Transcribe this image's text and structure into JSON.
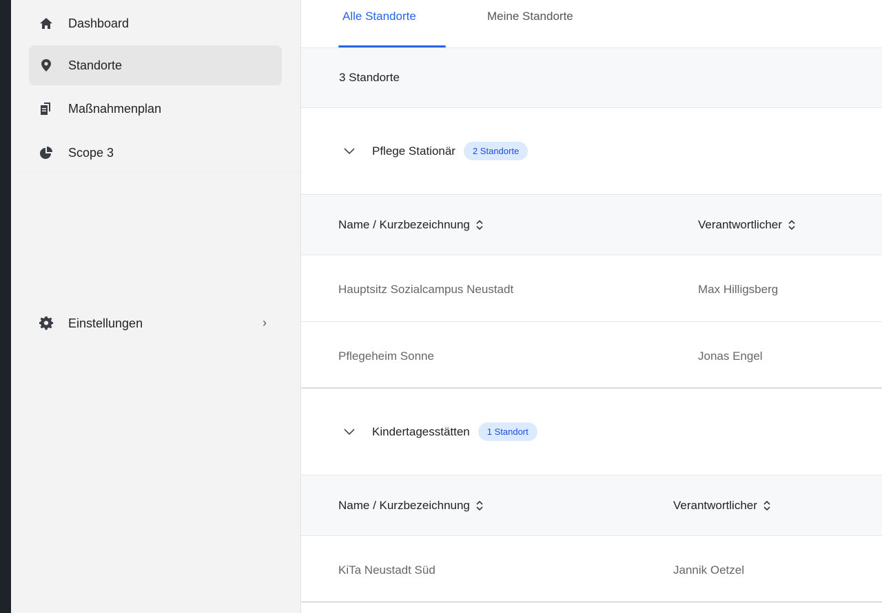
{
  "sidebar": {
    "items": [
      {
        "label": "Dashboard",
        "icon": "home-icon",
        "active": false
      },
      {
        "label": "Standorte",
        "icon": "map-pin-icon",
        "active": true
      },
      {
        "label": "Maßnahmenplan",
        "icon": "documents-icon",
        "active": false
      },
      {
        "label": "Scope 3",
        "icon": "pie-chart-icon",
        "active": false
      }
    ],
    "settings": {
      "label": "Einstellungen",
      "icon": "gear-icon"
    }
  },
  "tabs": [
    {
      "label": "Alle Standorte",
      "active": true
    },
    {
      "label": "Meine Standorte",
      "active": false
    }
  ],
  "count_label": "3 Standorte",
  "groups": [
    {
      "title": "Pflege Stationär",
      "badge": "2 Standorte",
      "columns": [
        "Name / Kurzbezeichnung",
        "Verantwortlicher"
      ],
      "rows": [
        {
          "name": "Hauptsitz Sozialcampus Neustadt",
          "owner": "Max Hilligsberg"
        },
        {
          "name": "Pflegeheim Sonne",
          "owner": "Jonas Engel"
        }
      ]
    },
    {
      "title": "Kindertagesstätten",
      "badge": "1 Standort",
      "columns": [
        "Name / Kurzbezeichnung",
        "Verantwortlicher"
      ],
      "rows": [
        {
          "name": "KiTa Neustadt Süd",
          "owner": "Jannik Oetzel"
        }
      ]
    }
  ],
  "colors": {
    "accent": "#2563eb",
    "badge_bg": "#dbeafe",
    "frame": "#1f2329"
  }
}
